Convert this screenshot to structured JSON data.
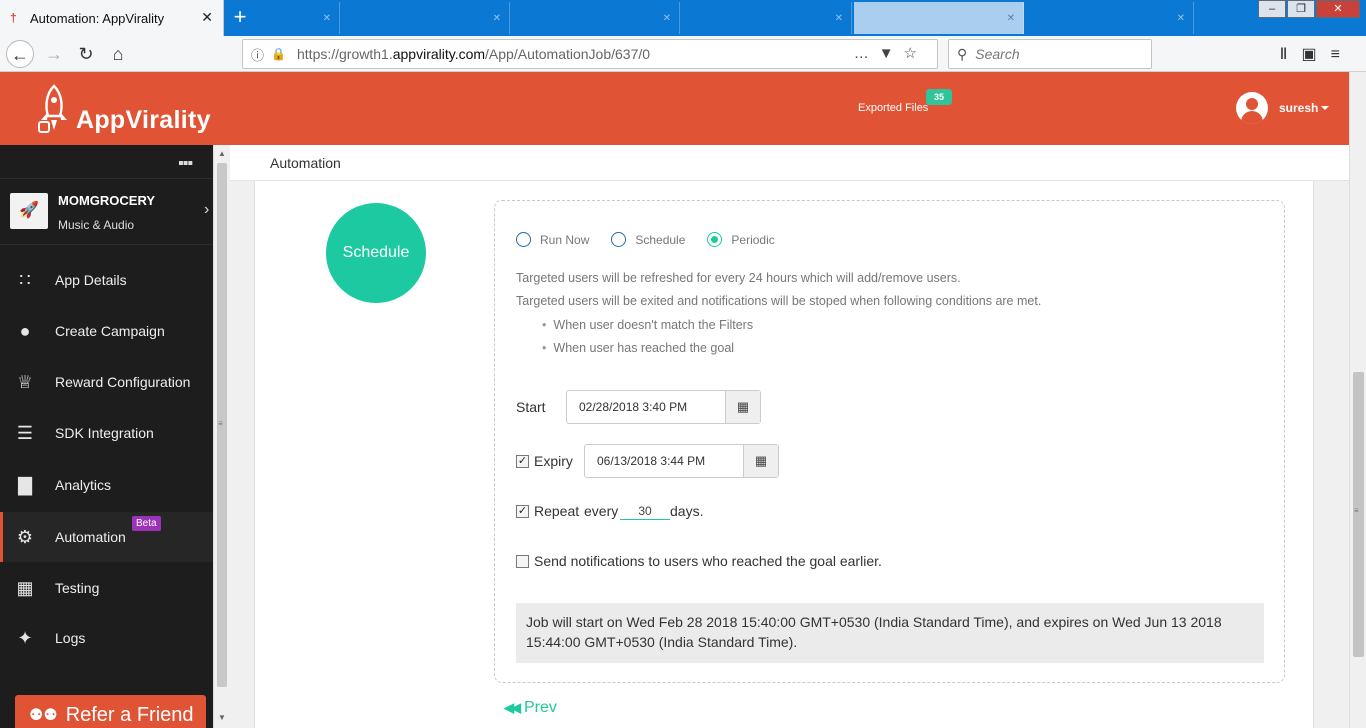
{
  "browser": {
    "active_tab_title": "Automation: AppVirality",
    "new_tab_icon": "plus-icon",
    "url_prefix": "https://growth1.",
    "url_host": "appvirality.com",
    "url_path": "/App/AutomationJob/637/0",
    "search_placeholder": "Search"
  },
  "header": {
    "logo_text": "AppVirality",
    "exported_files_label": "Exported Files",
    "exported_files_count": "35",
    "username": "suresh",
    "accent_color": "#e05335"
  },
  "sidebar": {
    "app": {
      "name": "MOMGROCERY",
      "category": "Music & Audio"
    },
    "items": [
      {
        "label": "App Details",
        "icon": "grid-icon"
      },
      {
        "label": "Create Campaign",
        "icon": "bulb-icon"
      },
      {
        "label": "Reward Configuration",
        "icon": "crown-icon"
      },
      {
        "label": "SDK Integration",
        "icon": "document-icon"
      },
      {
        "label": "Analytics",
        "icon": "bar-chart-icon"
      },
      {
        "label": "Automation",
        "icon": "gear-icon",
        "badge": "Beta",
        "active": true
      },
      {
        "label": "Testing",
        "icon": "layout-icon"
      },
      {
        "label": "Logs",
        "icon": "wand-icon"
      }
    ],
    "refer_label": "Refer a Friend"
  },
  "main": {
    "breadcrumb": "Automation",
    "step_label": "Schedule",
    "step_color": "#1dc9a0",
    "radios": [
      {
        "label": "Run Now",
        "selected": false
      },
      {
        "label": "Schedule",
        "selected": false
      },
      {
        "label": "Periodic",
        "selected": true
      }
    ],
    "desc1": "Targeted users will be refreshed for every 24 hours which will add/remove users.",
    "desc2": "Targeted users will be exited and notifications will be stoped when following conditions are met.",
    "bullets": [
      "When user doesn't match the Filters",
      "When user has reached the goal"
    ],
    "start_label": "Start",
    "start_value": "02/28/2018 3:40 PM",
    "expiry_label": "Expiry",
    "expiry_value": "06/13/2018 3:44 PM",
    "expiry_checked": true,
    "repeat_label": "Repeat",
    "repeat_every": "every",
    "repeat_value": "30",
    "repeat_unit": "days.",
    "repeat_checked": true,
    "notify_label": "Send notifications to users who reached the goal earlier.",
    "notify_checked": false,
    "summary": "Job will start on Wed Feb 28 2018 15:40:00 GMT+0530 (India Standard Time), and expires on Wed Jun 13 2018 15:44:00 GMT+0530 (India Standard Time).",
    "prev_label": "Prev"
  }
}
